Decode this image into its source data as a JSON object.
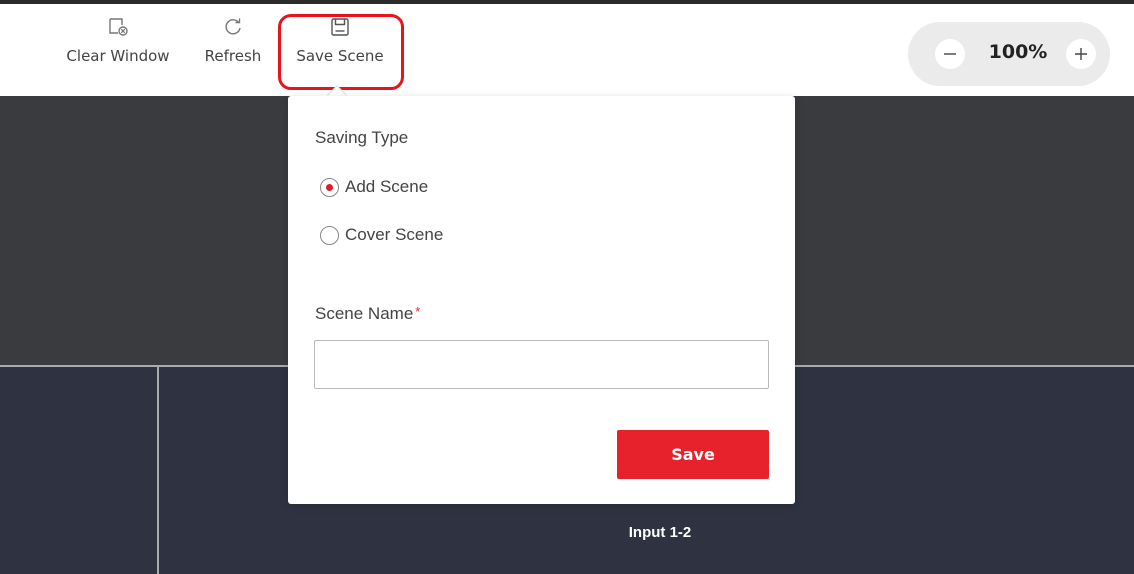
{
  "toolbar": {
    "clear_window_label": "Clear Window",
    "refresh_label": "Refresh",
    "save_scene_label": "Save Scene"
  },
  "zoom": {
    "value": "100%"
  },
  "canvas": {
    "tile_label": "Input 1-2"
  },
  "save_popup": {
    "saving_type_label": "Saving Type",
    "options": [
      {
        "label": "Add Scene",
        "selected": true
      },
      {
        "label": "Cover Scene",
        "selected": false
      }
    ],
    "scene_name_label": "Scene Name",
    "required_mark": "*",
    "scene_name_value": "",
    "save_button_label": "Save"
  },
  "colors": {
    "accent": "#e8222d",
    "highlight_outline": "#e8131c",
    "canvas_upper": "#3a3b3f",
    "canvas_lower": "#2f3241"
  }
}
